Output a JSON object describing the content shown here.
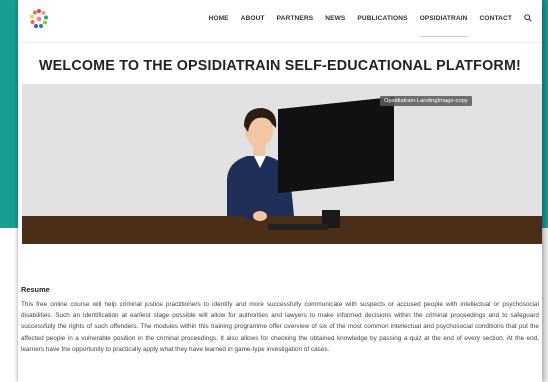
{
  "nav": {
    "items": [
      "HOME",
      "ABOUT",
      "PARTNERS",
      "NEWS",
      "PUBLICATIONS",
      "OPSIDIATRAIN",
      "CONTACT"
    ],
    "active_index": 5
  },
  "colors": {
    "background": "#1a9d95",
    "floor": "#4a2e17",
    "hero_wall": "#e2e2e2"
  },
  "page": {
    "title": "WELCOME TO THE OPSIDIATRAIN SELF-EDUCATIONAL PLATFORM!",
    "image_label": "Opsidiatrain-LandingImage-copy"
  },
  "resume": {
    "heading": "Resume",
    "body": "This free online course will help criminal justice practitioners to identify and more successfully communicate with suspects or accused people with intellectual or psychosocial disabilities. Such an identification at earliest stage possible will allow for authorities and lawyers to make informed decisions within the criminal proceedings and to safeguard successfully the rights of such offenders. The modules within this training programme offer overview of six of the most common intellectual and psychosocial conditions that put the affected people in a vulnerable position in the criminal proceedings. It also allows for checking the obtained knowledge by passing a quiz at the end of every section. At the end, learners have the opportunity to practically apply what they have learned in game-type investigation of cases."
  }
}
